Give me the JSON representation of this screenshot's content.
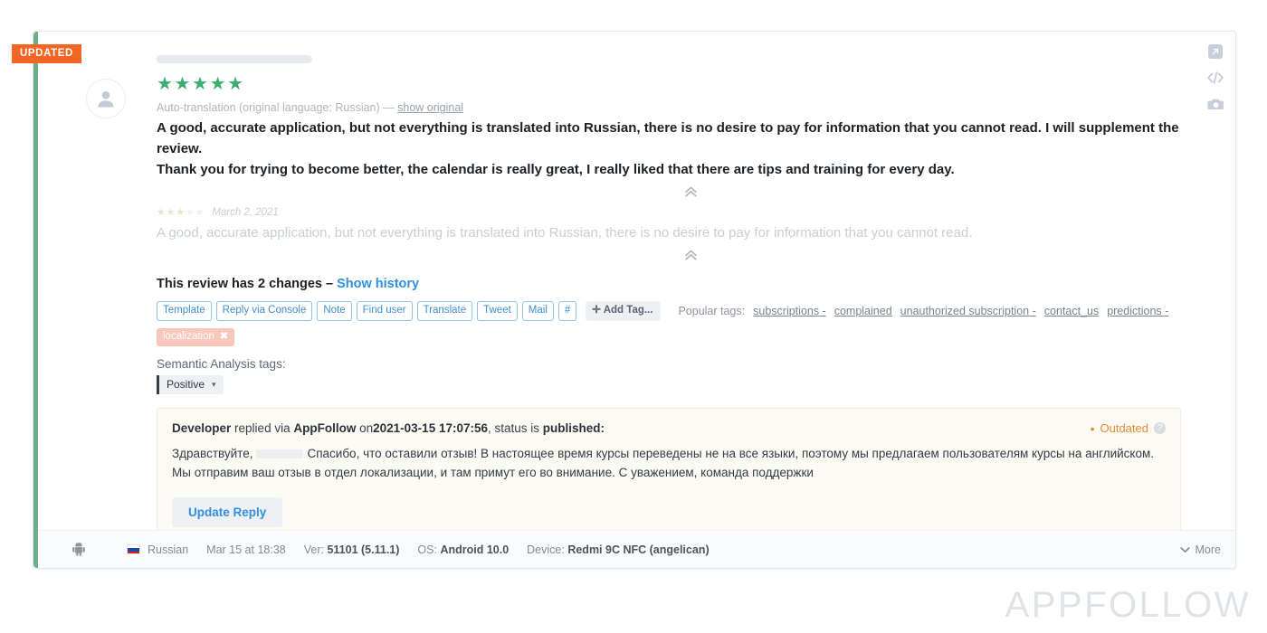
{
  "badge": {
    "updated": "UPDATED"
  },
  "actions": {
    "open_external": "open-in-new-icon",
    "view_code": "code-icon",
    "screenshot": "camera-icon"
  },
  "review": {
    "rating_stars": 5,
    "rating_glyphs": "★★★★★",
    "translation_notice": "Auto-translation (original language: Russian) —",
    "show_original": "show original",
    "text_line1": "A good, accurate application, but not everything is translated into Russian, there is no desire to pay for information that you cannot read. I will supplement the review.",
    "text_line2": "Thank you for trying to become better, the calendar is really great, I really liked that there are tips and training for every day."
  },
  "history": {
    "date": "March 2, 2021",
    "stars_filled": 3,
    "stars_total": 5,
    "text": "A good, accurate application, but not everything is translated into Russian, there is no desire to pay for information that you cannot read.",
    "changes_prefix": "This review has 2 changes –",
    "show_history": "Show history"
  },
  "tag_buttons": [
    "Template",
    "Reply via Console",
    "Note",
    "Find user",
    "Translate",
    "Tweet",
    "Mail",
    "#"
  ],
  "add_tag_label": "Add Tag...",
  "popular_tags": {
    "label": "Popular tags:",
    "items": [
      "subscriptions -",
      "complained",
      "unauthorized subscription -",
      "contact_us",
      "predictions -"
    ]
  },
  "assigned_tags": [
    {
      "label": "localization",
      "remove": "✖"
    }
  ],
  "semantic": {
    "label": "Semantic Analysis tags:",
    "value": "Positive",
    "caret": "▾"
  },
  "reply": {
    "author": "Developer",
    "via_text": "replied via",
    "platform": "AppFollow",
    "on_text": "on",
    "datetime": "2021-03-15 17:07:56",
    "status_text": ", status is",
    "status": "published:",
    "outdated_label": "Outdated",
    "outdated_dot": "•",
    "help": "?",
    "body_part1": "Здравствуйте,",
    "body_part2": "Спасибо, что оставили отзыв! В настоящее время курсы переведены не на все языки, поэтому мы предлагаем пользователям курсы на английском. Мы отправим ваш отзыв в отдел локализации, и там примут его во внимание. С уважением, команда поддержки",
    "update_button": "Update Reply"
  },
  "footer": {
    "platform_icon": "android-icon",
    "language": "Russian",
    "date": "Mar 15 at 18:38",
    "version_label": "Ver:",
    "version": "51101 (5.11.1)",
    "os_label": "OS:",
    "os": "Android 10.0",
    "device_label": "Device:",
    "device": "Redmi 9C NFC (angelican)",
    "more": "More"
  },
  "watermark": "APPFOLLOW",
  "colors": {
    "accent_green": "#6ab187",
    "badge_orange": "#f26522",
    "star_green": "#3dac6f",
    "link_blue": "#2f8fe0",
    "outdated_orange": "#e08b36",
    "chip_pink": "#f9c6bc"
  }
}
